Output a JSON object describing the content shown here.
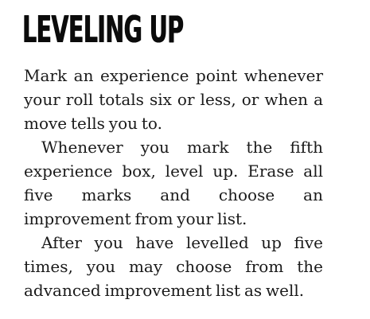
{
  "section": {
    "heading": "LEVELING UP",
    "paragraphs": [
      "Mark an experience point whenever your roll totals six or less, or when a move tells you to.",
      "Whenever you mark the fifth experi­ence box, level up. Erase all five marks and choose an improvement from your list.",
      "After you have levelled up five times, you may choose from the advanced improvement list as well."
    ]
  }
}
